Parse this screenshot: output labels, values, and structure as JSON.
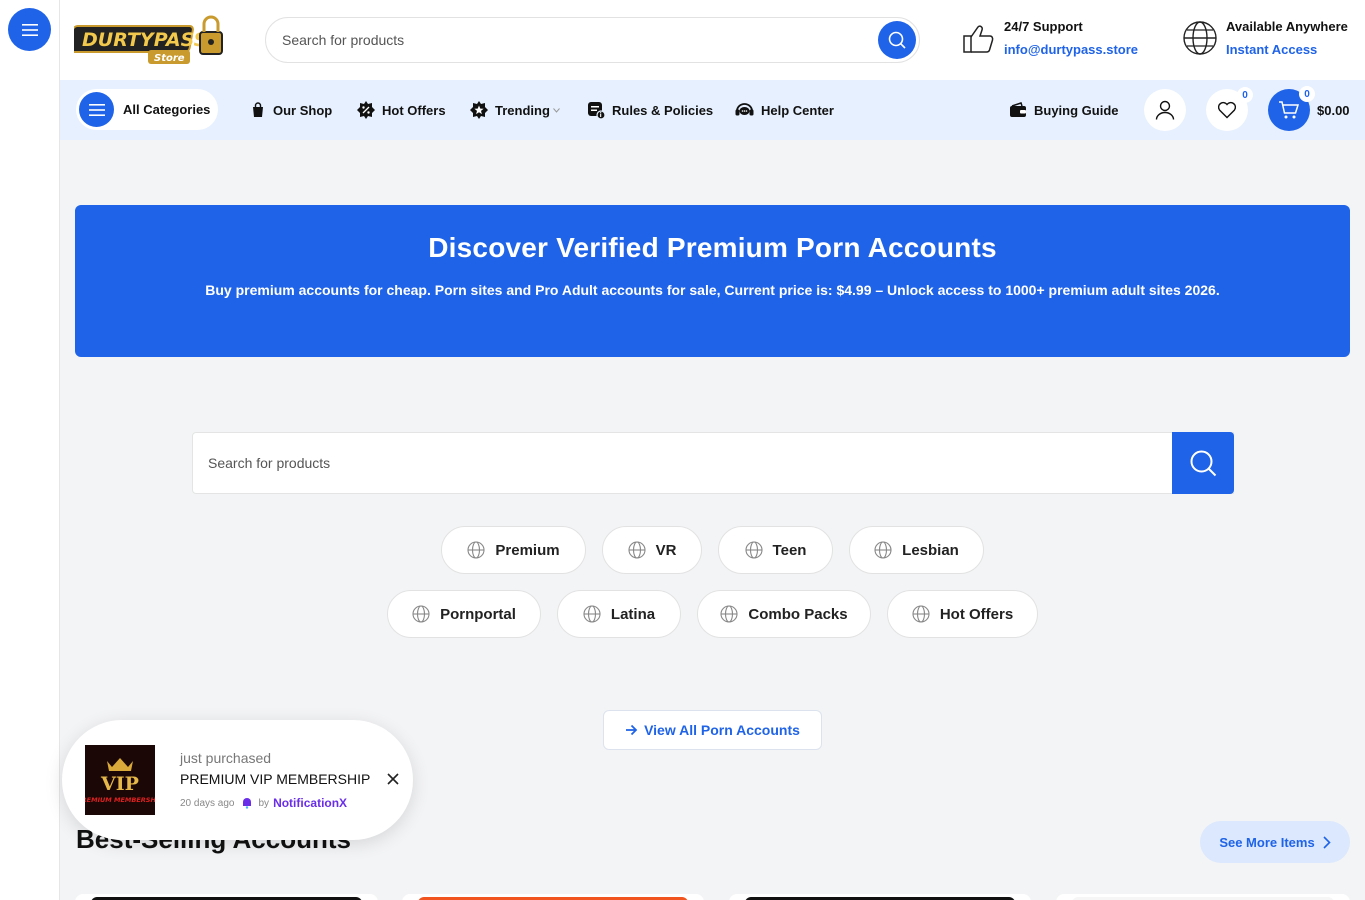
{
  "sidebar": {
    "menu_icon": "hamburger-icon"
  },
  "header": {
    "logo_text": "DURTYPASS",
    "logo_sub": "Store",
    "search_placeholder": "Search for products",
    "support": {
      "title": "24/7 Support",
      "email": "info@durtypass.store"
    },
    "availability": {
      "title": "Available Anywhere",
      "link": "Instant Access"
    }
  },
  "nav": {
    "all_categories": "All Categories",
    "items": [
      {
        "label": "Our Shop",
        "icon": "bag-icon"
      },
      {
        "label": "Hot Offers",
        "icon": "discount-badge-icon"
      },
      {
        "label": "Trending",
        "icon": "trending-badge-icon"
      },
      {
        "label": "Rules & Policies",
        "icon": "document-icon"
      },
      {
        "label": "Help Center",
        "icon": "headset-icon"
      }
    ],
    "buying_guide": "Buying Guide",
    "wishlist_count": "0",
    "cart_count": "0",
    "cart_total": "$0.00"
  },
  "hero": {
    "title": "Discover Verified Premium Porn Accounts",
    "subtitle": "Buy premium accounts for cheap. Porn sites and Pro Adult accounts for sale, Current price is: $4.99 – Unlock access to 1000+ premium adult sites 2026."
  },
  "search": {
    "placeholder": "Search for products"
  },
  "categories": [
    {
      "label": "Premium"
    },
    {
      "label": "VR"
    },
    {
      "label": "Teen"
    },
    {
      "label": "Lesbian"
    },
    {
      "label": "Pornportal"
    },
    {
      "label": "Latina"
    },
    {
      "label": "Combo Packs"
    },
    {
      "label": "Hot Offers"
    }
  ],
  "view_all": "View All Porn Accounts",
  "best_selling": {
    "title": "Best-Selling Accounts",
    "see_more": "See More Items"
  },
  "notification": {
    "action": "just purchased",
    "product": "PREMIUM VIP MEMBERSHIP",
    "thumb_title": "VIP",
    "thumb_sub": "PREMIUM MEMBERSHIP",
    "time": "20 days ago",
    "by": "by",
    "brand": "NotificationX"
  },
  "colors": {
    "accent": "#1f63e8",
    "nav_bg": "#e6f0fe",
    "page_bg": "#f3f4f6"
  }
}
